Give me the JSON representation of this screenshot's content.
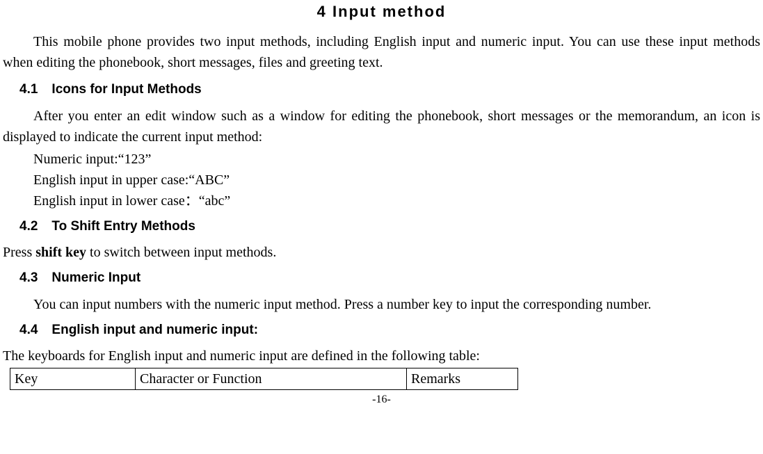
{
  "title": "4  Input method",
  "intro": "This mobile phone provides two input methods, including English input and numeric input. You can use these input methods when editing the phonebook, short messages, files and greeting text.",
  "sections": {
    "s41": {
      "num": "4.1",
      "heading": "Icons for Input Methods",
      "p1": "After you enter an edit window such as a window for editing the phonebook, short messages or the memorandum, an icon is displayed to indicate the current input method:",
      "l1": "Numeric input:“123”",
      "l2": "English input in upper case:“ABC”",
      "l3": "English input in lower case：“abc”"
    },
    "s42": {
      "num": "4.2",
      "heading": "To Shift Entry Methods",
      "p1_pre": "Press ",
      "p1_bold": "shift key",
      "p1_post": " to switch between input methods."
    },
    "s43": {
      "num": "4.3",
      "heading": "Numeric Input",
      "p1": "You can input numbers with the numeric input method. Press a number key to input the corresponding number."
    },
    "s44": {
      "num": "4.4",
      "heading": "English input and numeric input:",
      "p1": "The keyboards for English input and numeric input are defined in the following table:"
    }
  },
  "table": {
    "headers": {
      "key": "Key",
      "char": "Character or Function",
      "remarks": "Remarks"
    }
  },
  "page_number": "-16-"
}
